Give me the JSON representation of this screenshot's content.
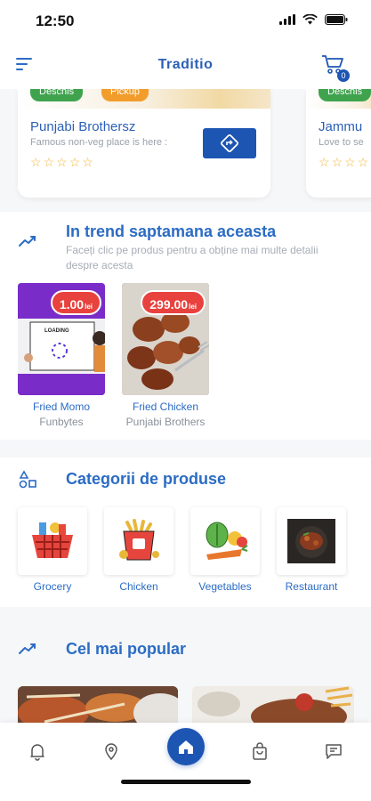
{
  "status": {
    "time": "12:50"
  },
  "header": {
    "title": "Traditio",
    "cart_count": "0"
  },
  "restaurants": [
    {
      "name": "Punjabi Brothersz",
      "description": "Famous non-veg place is here :",
      "tags": [
        "Deschis",
        "Pickup"
      ]
    },
    {
      "name": "Jammu",
      "description": "Love to se",
      "tags": [
        "Deschis"
      ]
    }
  ],
  "trending": {
    "title": "In trend saptamana aceasta",
    "subtitle": "Faceți clic pe produs pentru a obține mai multe detalii despre acesta",
    "items": [
      {
        "price": "1.00",
        "currency": "lei",
        "name": "Fried Momo",
        "shop": "Funbytes",
        "image_text": "LOADING"
      },
      {
        "price": "299.00",
        "currency": "lei",
        "name": "Fried Chicken",
        "shop": "Punjabi Brothers"
      }
    ]
  },
  "categories": {
    "title": "Categorii de produse",
    "items": [
      {
        "label": "Grocery",
        "icon": "grocery-basket-icon"
      },
      {
        "label": "Chicken",
        "icon": "chicken-bucket-icon"
      },
      {
        "label": "Vegetables",
        "icon": "vegetables-icon"
      },
      {
        "label": "Restaurant",
        "icon": "restaurant-dish-icon"
      }
    ]
  },
  "popular": {
    "title": "Cel mai popular"
  },
  "nav": [
    "bell-icon",
    "location-pin-icon",
    "home-icon",
    "shopping-bag-icon",
    "chat-icon"
  ],
  "colors": {
    "primary": "#1d55b3",
    "accent_text": "#2b6cc4",
    "price_badge": "#e8423e",
    "open_tag": "#3fa34d",
    "pickup_tag": "#f29d2b",
    "star": "#f2b53a"
  }
}
